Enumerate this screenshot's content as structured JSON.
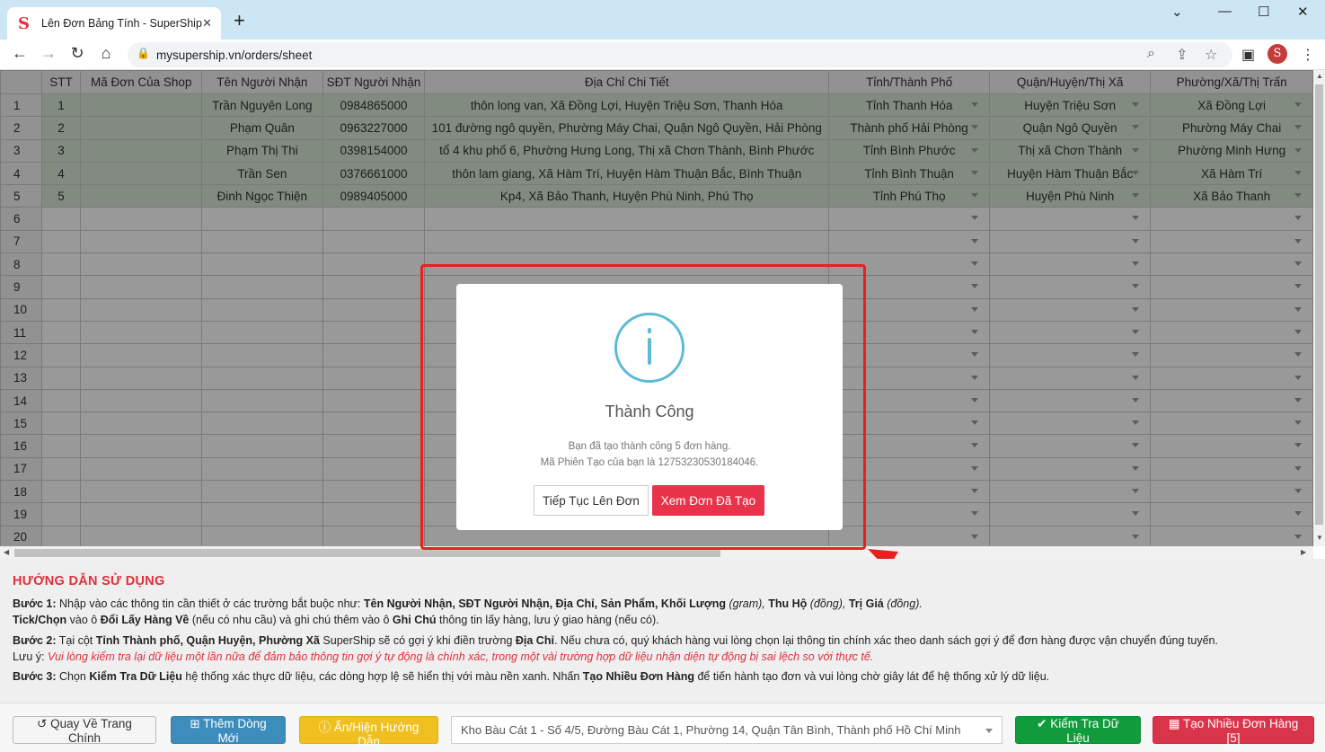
{
  "browser": {
    "tab_title": "Lên Đơn Bảng Tính - SuperShip",
    "favicon_letter": "S",
    "url": "mysupership.vn/orders/sheet",
    "profile_letter": "S"
  },
  "sheet": {
    "headers": [
      "STT",
      "Mã Đơn Của Shop",
      "Tên Người Nhận",
      "SĐT Người Nhận",
      "Địa Chỉ Chi Tiết",
      "Tỉnh/Thành Phố",
      "Quận/Huyện/Thị Xã",
      "Phường/Xã/Thị Trấn"
    ],
    "rows": [
      {
        "rn": "1",
        "stt": "1",
        "shop": "",
        "name": "Trần Nguyên Long",
        "phone": "0984865000",
        "addr": "thôn long van, Xã Đồng Lợi, Huyện Triệu Sơn, Thanh Hóa",
        "prov": "Tỉnh Thanh Hóa",
        "dist": "Huyện Triệu Sơn",
        "ward": "Xã Đồng Lợi"
      },
      {
        "rn": "2",
        "stt": "2",
        "shop": "",
        "name": "Phạm Quân",
        "phone": "0963227000",
        "addr": "101 đường ngô quyền, Phường Máy Chai, Quận Ngô Quyền, Hải Phòng",
        "prov": "Thành phố Hải Phòng",
        "dist": "Quận Ngô Quyền",
        "ward": "Phường Máy Chai"
      },
      {
        "rn": "3",
        "stt": "3",
        "shop": "",
        "name": "Phạm Thị Thi",
        "phone": "0398154000",
        "addr": "tổ 4 khu phố 6, Phường Hưng Long, Thị xã Chơn Thành, Bình Phước",
        "prov": "Tỉnh Bình Phước",
        "dist": "Thị xã Chơn Thành",
        "ward": "Phường Minh Hưng"
      },
      {
        "rn": "4",
        "stt": "4",
        "shop": "",
        "name": "Trần Sen",
        "phone": "0376661000",
        "addr": "thôn lam giang, Xã Hàm Trí, Huyện Hàm Thuận Bắc, Bình Thuận",
        "prov": "Tỉnh Bình Thuận",
        "dist": "Huyện Hàm Thuận Bắc",
        "ward": "Xã Hàm Trí"
      },
      {
        "rn": "5",
        "stt": "5",
        "shop": "",
        "name": "Đinh Ngọc Thiện",
        "phone": "0989405000",
        "addr": "Kp4, Xã Bảo Thanh, Huyện Phù Ninh, Phú Thọ",
        "prov": "Tỉnh Phú Thọ",
        "dist": "Huyện Phù Ninh",
        "ward": "Xã Bảo Thanh"
      }
    ],
    "empty_rows": [
      "6",
      "7",
      "8",
      "9",
      "10",
      "11",
      "12",
      "13",
      "14",
      "15",
      "16",
      "17",
      "18",
      "19",
      "20"
    ]
  },
  "modal": {
    "title": "Thành Công",
    "line1": "Bạn đã tạo thành công 5 đơn hàng.",
    "line2": "Mã Phiên Tạo của bạn là 12753230530184046.",
    "continue_label": "Tiếp Tục Lên Đơn",
    "view_label": "Xem Đơn Đã Tạo"
  },
  "guide": {
    "title": "HƯỚNG DẪN SỬ DỤNG",
    "step1_label": "Bước 1:",
    "step1_a": " Nhập vào các thông tin cần thiết ở các trường bắt buộc như: ",
    "step1_fields": "Tên Người Nhận, SĐT Người Nhận, Địa Chỉ, Sản Phẩm, Khối Lượng",
    "step1_gram": " (gram), ",
    "step1_cod": "Thu Hộ",
    "step1_dong1": " (đồng), ",
    "step1_value": "Trị Giá",
    "step1_dong2": " (đồng).",
    "step1b_label": "Tick/Chọn",
    "step1b_a": " vào ô ",
    "step1b_field": "Đổi Lấy Hàng Về",
    "step1b_b": " (nếu có nhu cầu) và ghi chú thêm vào ô ",
    "step1b_note": "Ghi Chú",
    "step1b_c": " thông tin lấy hàng, lưu ý giao hàng (nếu có).",
    "step2_label": "Bước 2:",
    "step2_a": " Tại cột ",
    "step2_cols": "Tỉnh Thành phố, Quận Huyện, Phường Xã",
    "step2_b": " SuperShip sẽ có gợi ý khi điền trường ",
    "step2_field": "Địa Chỉ",
    "step2_c": ". Nếu chưa có, quý khách hàng vui lòng chọn lại thông tin chính xác theo danh sách gợi ý để đơn hàng được vận chuyển đúng tuyến.",
    "note_label": "Lưu ý: ",
    "note_text": "Vui lòng kiểm tra lại dữ liệu một lần nữa để đảm bảo thông tin gợi ý tự động là chính xác, trong một vài trường hợp dữ liệu nhận diện tự động bị sai lệch so với thực tế.",
    "step3_label": "Bước 3:",
    "step3_a": " Chọn ",
    "step3_check": "Kiểm Tra Dữ Liệu",
    "step3_b": " hệ thống xác thực dữ liệu, các dòng hợp lệ sẽ hiển thị với màu nền xanh. Nhấn ",
    "step3_create": "Tạo Nhiều Đơn Hàng",
    "step3_c": " để tiến hành tạo đơn và vui lòng chờ giây lát để hệ thống xử lý dữ liệu."
  },
  "footer": {
    "home_label": "Quay Về Trang Chính",
    "add_row_label": "Thêm Dòng Mới",
    "toggle_guide_label": "Ẩn/Hiện Hướng Dẫn",
    "warehouse_value": "Kho Bàu Cát 1 - Số 4/5, Đường Bàu Cát 1, Phường 14, Quận Tân Bình, Thành phố Hồ Chí Minh",
    "check_label": "Kiểm Tra Dữ Liệu",
    "create_label": "Tạo Nhiều Đơn Hàng [5]"
  },
  "colors": {
    "valid_row_bg": "#d8e8d6",
    "primary_red": "#e8334a",
    "info_blue": "#5bbbd4",
    "annotation_red": "#e82020"
  }
}
